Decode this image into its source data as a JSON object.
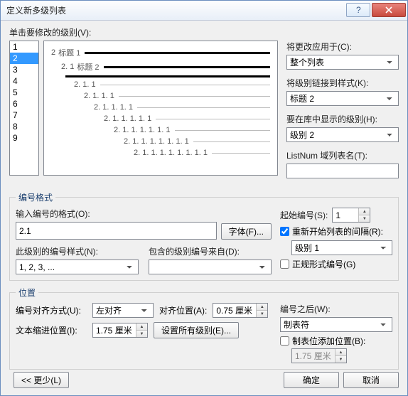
{
  "title": "定义新多级列表",
  "click_level_label": "单击要修改的级别(V):",
  "levels": [
    "1",
    "2",
    "3",
    "4",
    "5",
    "6",
    "7",
    "8",
    "9"
  ],
  "selected_level_index": 1,
  "preview": {
    "rows": [
      {
        "num": "2",
        "lbl": "标题 1",
        "indent": 0,
        "style": "bold1"
      },
      {
        "num": "2. 1",
        "lbl": "标题 2",
        "indent": 14,
        "style": "bold2"
      },
      {
        "num": "",
        "lbl": "",
        "indent": 14,
        "style": "bold2"
      },
      {
        "num": "2. 1. 1",
        "lbl": "",
        "indent": 32,
        "style": "sub"
      },
      {
        "num": "2. 1. 1. 1",
        "lbl": "",
        "indent": 46,
        "style": "sub"
      },
      {
        "num": "2. 1. 1. 1. 1",
        "lbl": "",
        "indent": 60,
        "style": "sub"
      },
      {
        "num": "2. 1. 1. 1. 1. 1",
        "lbl": "",
        "indent": 74,
        "style": "sub"
      },
      {
        "num": "2. 1. 1. 1. 1. 1. 1",
        "lbl": "",
        "indent": 88,
        "style": "sub"
      },
      {
        "num": "2. 1. 1. 1. 1. 1. 1. 1",
        "lbl": "",
        "indent": 102,
        "style": "sub"
      },
      {
        "num": "2. 1. 1. 1. 1. 1. 1. 1. 1",
        "lbl": "",
        "indent": 116,
        "style": "sub"
      }
    ]
  },
  "apply_to_label": "将更改应用于(C):",
  "apply_to_value": "整个列表",
  "link_style_label": "将级别链接到样式(K):",
  "link_style_value": "标题 2",
  "gallery_level_label": "要在库中显示的级别(H):",
  "gallery_level_value": "级别 2",
  "listnum_label": "ListNum 域列表名(T):",
  "listnum_value": "",
  "number_format_legend": "编号格式",
  "enter_format_label": "输入编号的格式(O):",
  "enter_format_value": "2.1",
  "font_btn": "字体(F)...",
  "start_at_label": "起始编号(S):",
  "start_at_value": "1",
  "restart_label": "重新开始列表的间隔(R):",
  "restart_checked": true,
  "restart_value": "级别 1",
  "legal_label": "正规形式编号(G)",
  "legal_checked": false,
  "number_style_label": "此级别的编号样式(N):",
  "number_style_value": "1, 2, 3, ...",
  "include_from_label": "包含的级别编号来自(D):",
  "include_from_value": "",
  "position_legend": "位置",
  "align_label": "编号对齐方式(U):",
  "align_value": "左对齐",
  "align_at_label": "对齐位置(A):",
  "align_at_value": "0.75 厘米",
  "indent_label": "文本缩进位置(I):",
  "indent_value": "1.75 厘米",
  "set_all_btn": "设置所有级别(E)...",
  "follow_label": "编号之后(W):",
  "follow_value": "制表符",
  "tab_stop_label": "制表位添加位置(B):",
  "tab_stop_checked": false,
  "tab_stop_value": "1.75 厘米",
  "less_btn": "<< 更少(L)",
  "ok_btn": "确定",
  "cancel_btn": "取消"
}
